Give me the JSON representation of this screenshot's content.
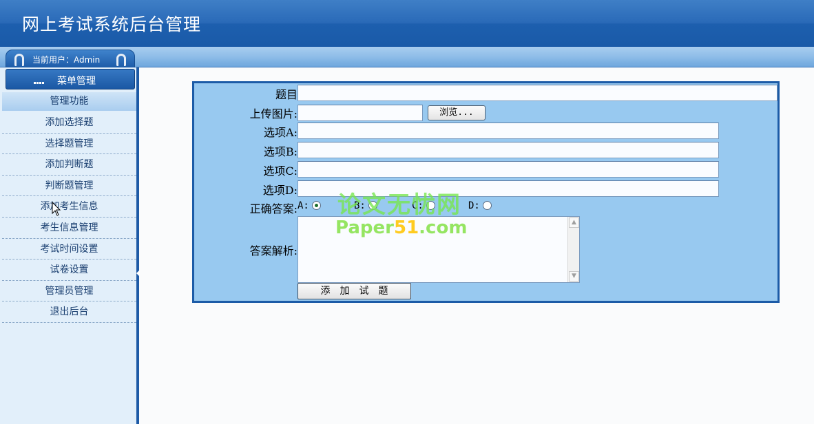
{
  "header": {
    "title": "网上考试系统后台管理"
  },
  "user": {
    "label": "当前用户：Admin"
  },
  "sidebar": {
    "menu_title": "菜单管理",
    "group_title": "管理功能",
    "items": [
      {
        "label": "添加选择题"
      },
      {
        "label": "选择题管理"
      },
      {
        "label": "添加判断题"
      },
      {
        "label": "判断题管理"
      },
      {
        "label": "添加考生信息"
      },
      {
        "label": "考生信息管理"
      },
      {
        "label": "考试时间设置"
      },
      {
        "label": "试卷设置"
      },
      {
        "label": "管理员管理"
      },
      {
        "label": "退出后台"
      }
    ]
  },
  "form": {
    "question_label": "题目",
    "image_label": "上传图片:",
    "browse_label": "浏览...",
    "option_a_label": "选项A:",
    "option_b_label": "选项B:",
    "option_c_label": "选项C:",
    "option_d_label": "选项D:",
    "answer_label": "正确答案:",
    "answers": [
      {
        "label": "A:",
        "checked": true
      },
      {
        "label": "B:",
        "checked": false
      },
      {
        "label": "C:",
        "checked": false
      },
      {
        "label": "D:",
        "checked": false
      }
    ],
    "analysis_label": "答案解析:",
    "submit_label": "添加试题"
  },
  "watermark": {
    "line1": "论文无忧网",
    "line2_a": "Paper",
    "line2_b": "51",
    "line2_c": ".com"
  },
  "colors": {
    "header": "#1d5fae",
    "panel": "#98c9f0",
    "panel_border": "#1c5ba7",
    "sidebar": "#e2effa"
  }
}
